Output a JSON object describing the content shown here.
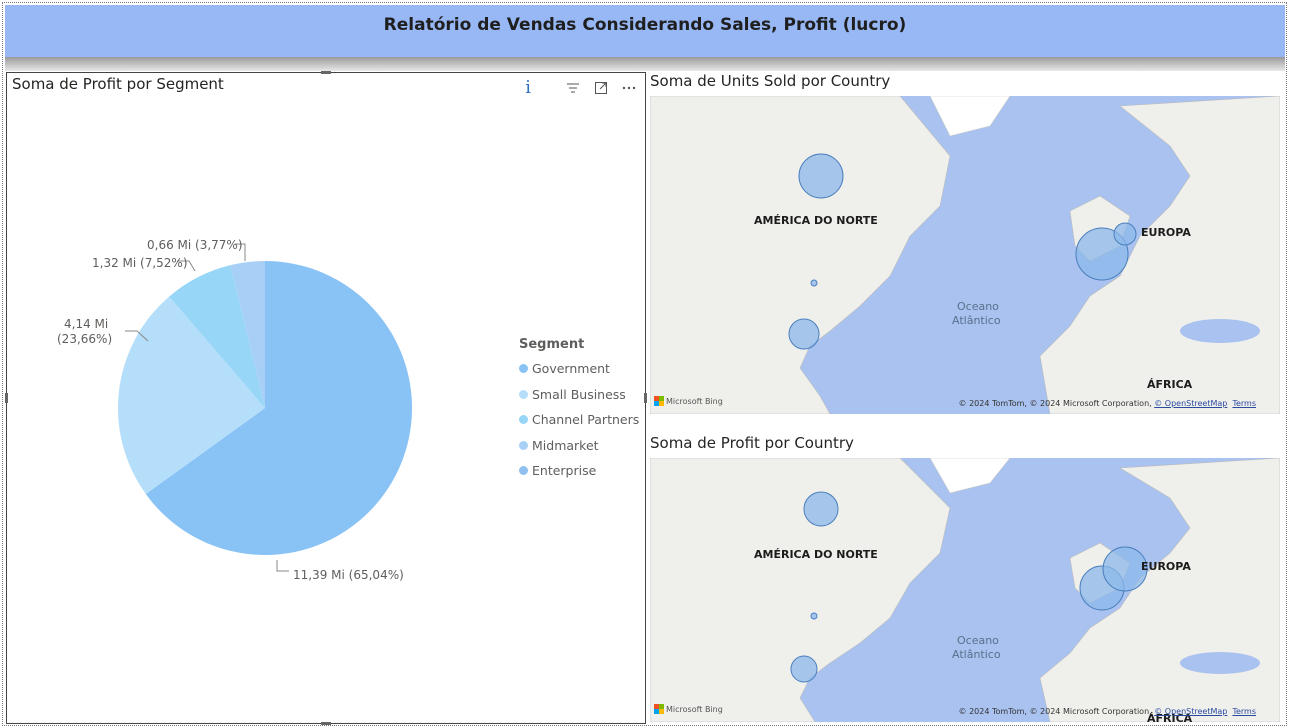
{
  "report": {
    "title": "Relatório de Vendas Considerando Sales, Profit (lucro)"
  },
  "pie": {
    "title": "Soma de Profit por Segment",
    "info_icon": "i",
    "legend_title": "Segment",
    "segments": [
      {
        "name": "Government",
        "label": "11,39 Mi (65,04%)",
        "color": "#89c2f5"
      },
      {
        "name": "Small Business",
        "label_line1": "4,14 Mi",
        "label_line2": "(23,66%)",
        "color": "#b5defa"
      },
      {
        "name": "Channel Partners",
        "label": "1,32 Mi (7,52%)",
        "color": "#97d6f7"
      },
      {
        "name": "Midmarket",
        "label": "0,66 Mi (3,77%)",
        "color": "#a8d0f7"
      },
      {
        "name": "Enterprise",
        "color": "#8fc0f0"
      }
    ]
  },
  "chart_data": {
    "type": "pie",
    "title": "Soma de Profit por Segment",
    "legend_title": "Segment",
    "legend_position": "right",
    "categories": [
      "Government",
      "Small Business",
      "Channel Partners",
      "Midmarket",
      "Enterprise"
    ],
    "values": [
      11.39,
      4.14,
      1.32,
      0.66,
      0
    ],
    "percents": [
      65.04,
      23.66,
      7.52,
      3.77,
      0
    ],
    "unit": "Mi"
  },
  "map_units": {
    "title": "Soma de Units Sold por Country",
    "labels": {
      "north_america": "AMÉRICA DO NORTE",
      "europe": "EUROPA",
      "ocean_line1": "Oceano",
      "ocean_line2": "Atlântico",
      "africa": "ÁFRICA"
    },
    "attribution": "© 2024 TomTom, © 2024 Microsoft Corporation, ",
    "osm": "© OpenStreetMap",
    "terms": "Terms",
    "bing": "Microsoft Bing"
  },
  "map_profit": {
    "title": "Soma de Profit por Country",
    "labels": {
      "north_america": "AMÉRICA DO NORTE",
      "europe": "EUROPA",
      "ocean_line1": "Oceano",
      "ocean_line2": "Atlântico",
      "africa": "ÁFRICA"
    },
    "attribution": "© 2024 TomTom, © 2024 Microsoft Corporation, ",
    "osm": "© OpenStreetMap",
    "terms": "Terms",
    "bing": "Microsoft Bing"
  }
}
